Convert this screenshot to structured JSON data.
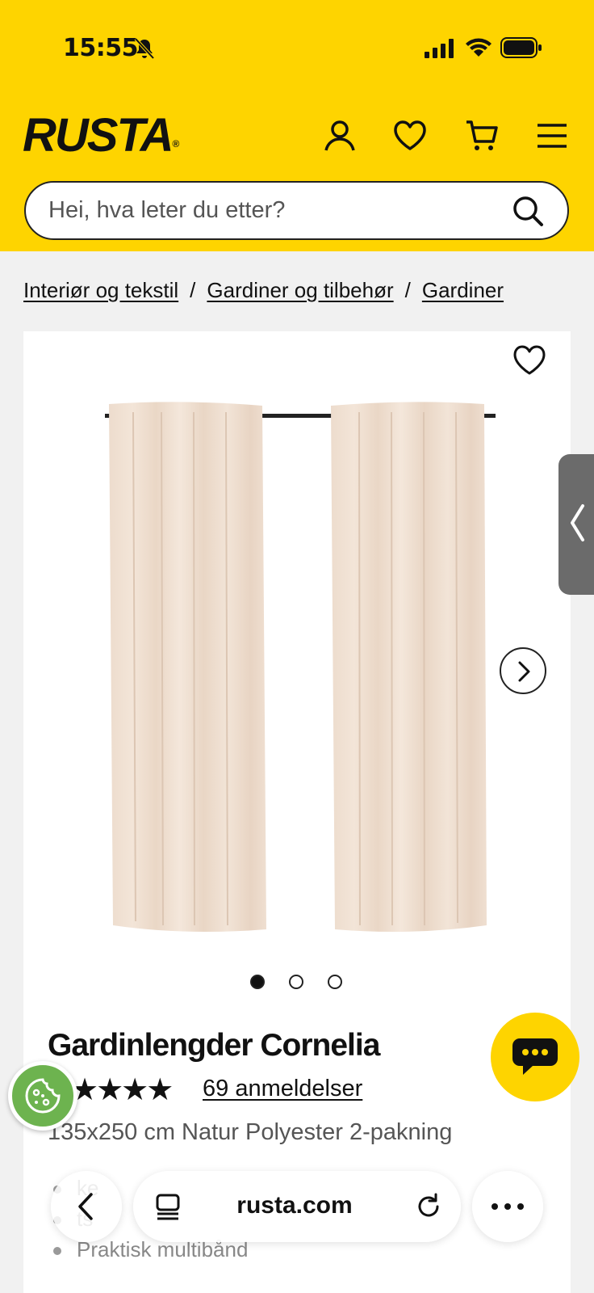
{
  "status_bar": {
    "time": "15:55"
  },
  "header": {
    "logo_text": "RUSTA",
    "logo_mark": "®",
    "brand_color": "#fed400",
    "icons": [
      "user-icon",
      "heart-icon",
      "cart-icon",
      "menu-icon"
    ]
  },
  "search": {
    "placeholder": "Hei, hva leter du etter?"
  },
  "breadcrumb": {
    "items": [
      "Interiør og tekstil",
      "Gardiner og tilbehør",
      "Gardiner"
    ],
    "separator": "/"
  },
  "product": {
    "title": "Gardinlengder Cornelia",
    "stars": "★★★★",
    "rating_stars_shown": 4,
    "reviews_label": "69 anmeldelser",
    "variant": "135x250 cm Natur Polyester 2-pakning",
    "features": [
      "ke",
      "ts",
      "Praktisk multibånd"
    ],
    "image_count": 3,
    "active_image": 1
  },
  "browser": {
    "url": "rusta.com"
  }
}
